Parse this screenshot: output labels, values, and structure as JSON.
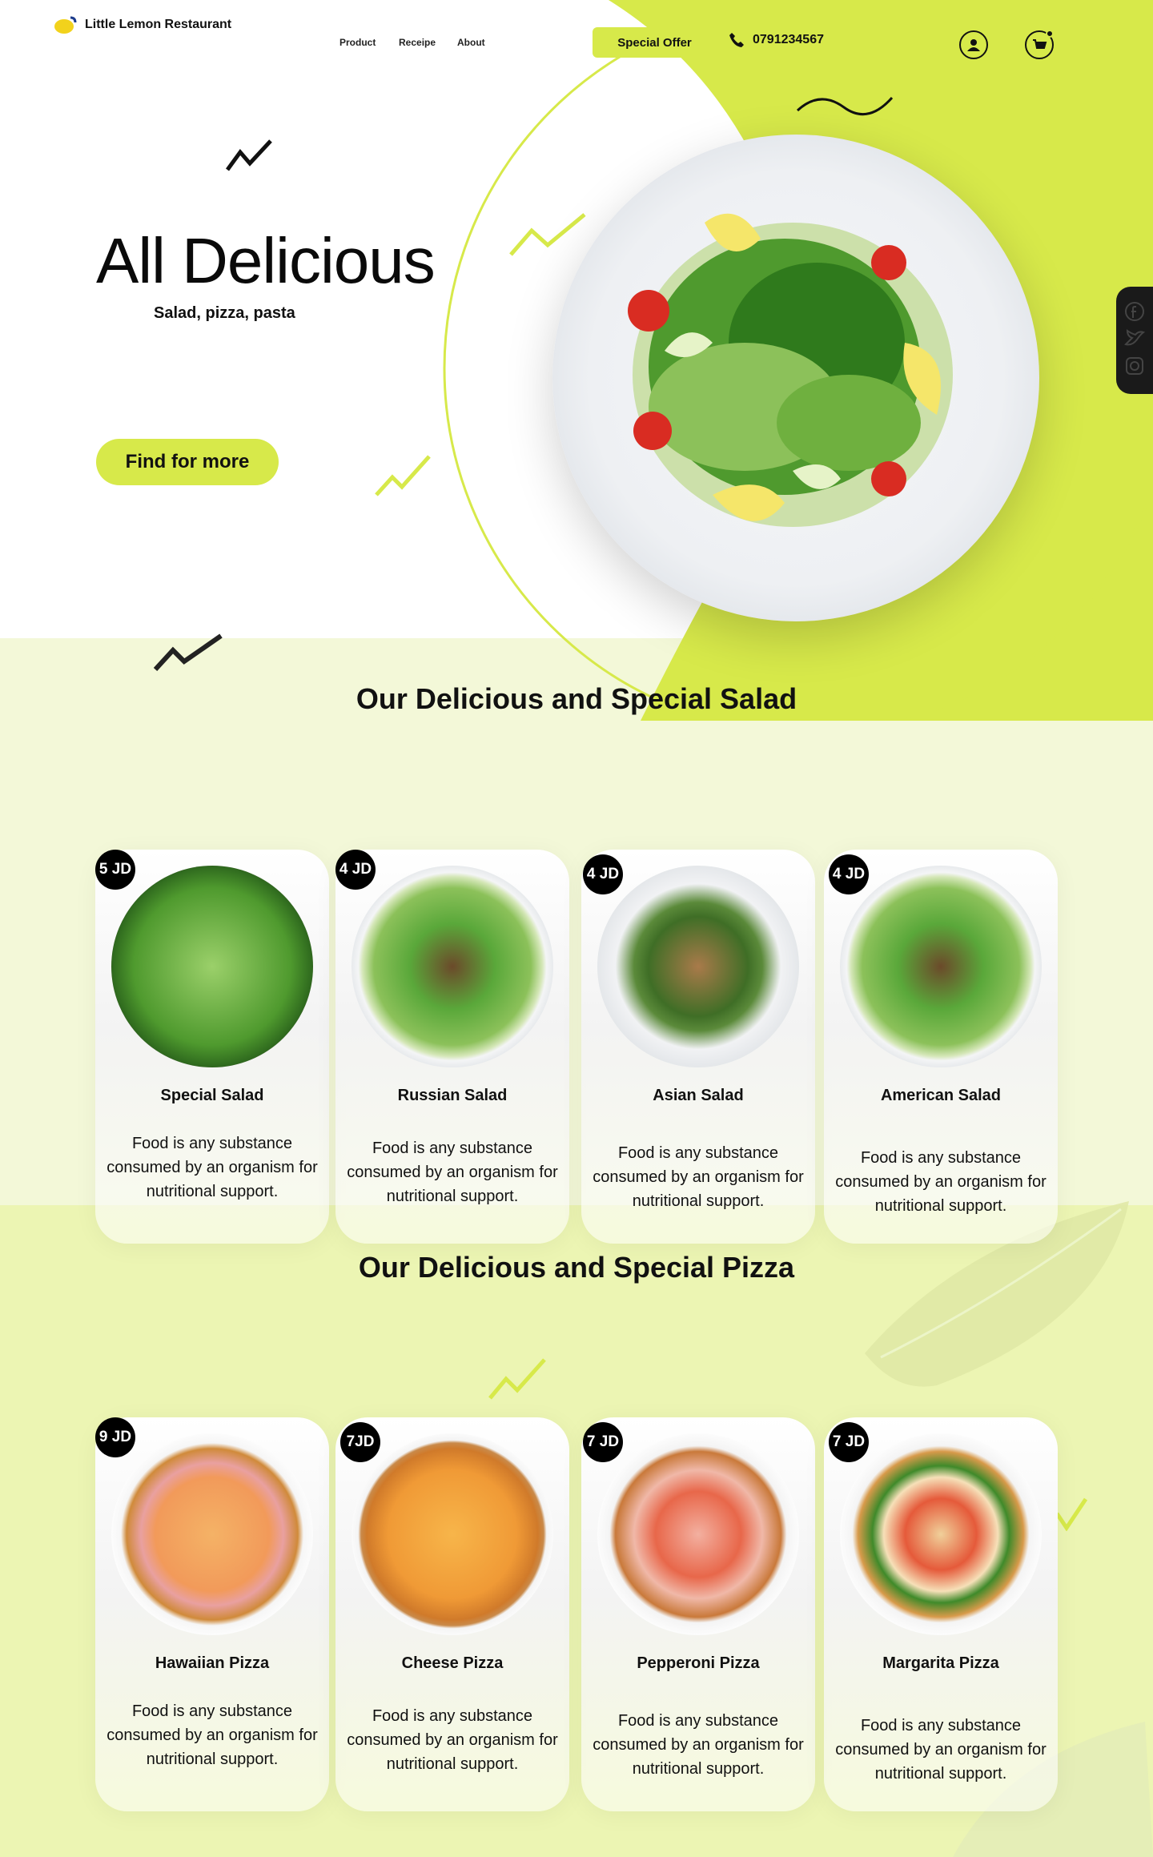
{
  "header": {
    "brand": "Little Lemon Restaurant",
    "nav": [
      "Product",
      "Receipe",
      "About"
    ],
    "special_offer": "Special Offer",
    "phone": "0791234567"
  },
  "hero": {
    "title": "All Delicious",
    "subtitle": "Salad, pizza, pasta",
    "cta": "Find for more"
  },
  "colors": {
    "accent": "#d7e94a",
    "pale": "#f3f8d8",
    "pizza_bg": "#ecf5b3"
  },
  "salad_section": {
    "title": "Our Delicious and Special Salad",
    "items": [
      {
        "price": "5 JD",
        "name": "Special Salad",
        "desc": "Food is any substance consumed by an organism for nutritional support."
      },
      {
        "price": "4 JD",
        "name": "Russian Salad",
        "desc": "Food is any substance consumed by an organism for nutritional support."
      },
      {
        "price": "4 JD",
        "name": "Asian Salad",
        "desc": "Food is any substance consumed by an organism for nutritional support."
      },
      {
        "price": "4 JD",
        "name": "American Salad",
        "desc": "Food is any substance consumed by an organism for nutritional support."
      }
    ]
  },
  "pizza_section": {
    "title": "Our Delicious and Special Pizza",
    "items": [
      {
        "price": "9 JD",
        "name": "Hawaiian Pizza",
        "desc": "Food is any substance consumed by an organism for nutritional support."
      },
      {
        "price": "7JD",
        "name": "Cheese Pizza",
        "desc": "Food is any substance consumed by an organism for nutritional support."
      },
      {
        "price": "7 JD",
        "name": "Pepperoni Pizza",
        "desc": "Food is any substance consumed by an organism for nutritional support."
      },
      {
        "price": "7 JD",
        "name": "Margarita Pizza",
        "desc": "Food is any substance consumed by an organism for nutritional support."
      }
    ]
  },
  "icons": [
    "lemon-logo-icon",
    "phone-icon",
    "user-icon",
    "cart-icon",
    "facebook-icon",
    "twitter-icon",
    "instagram-icon"
  ]
}
